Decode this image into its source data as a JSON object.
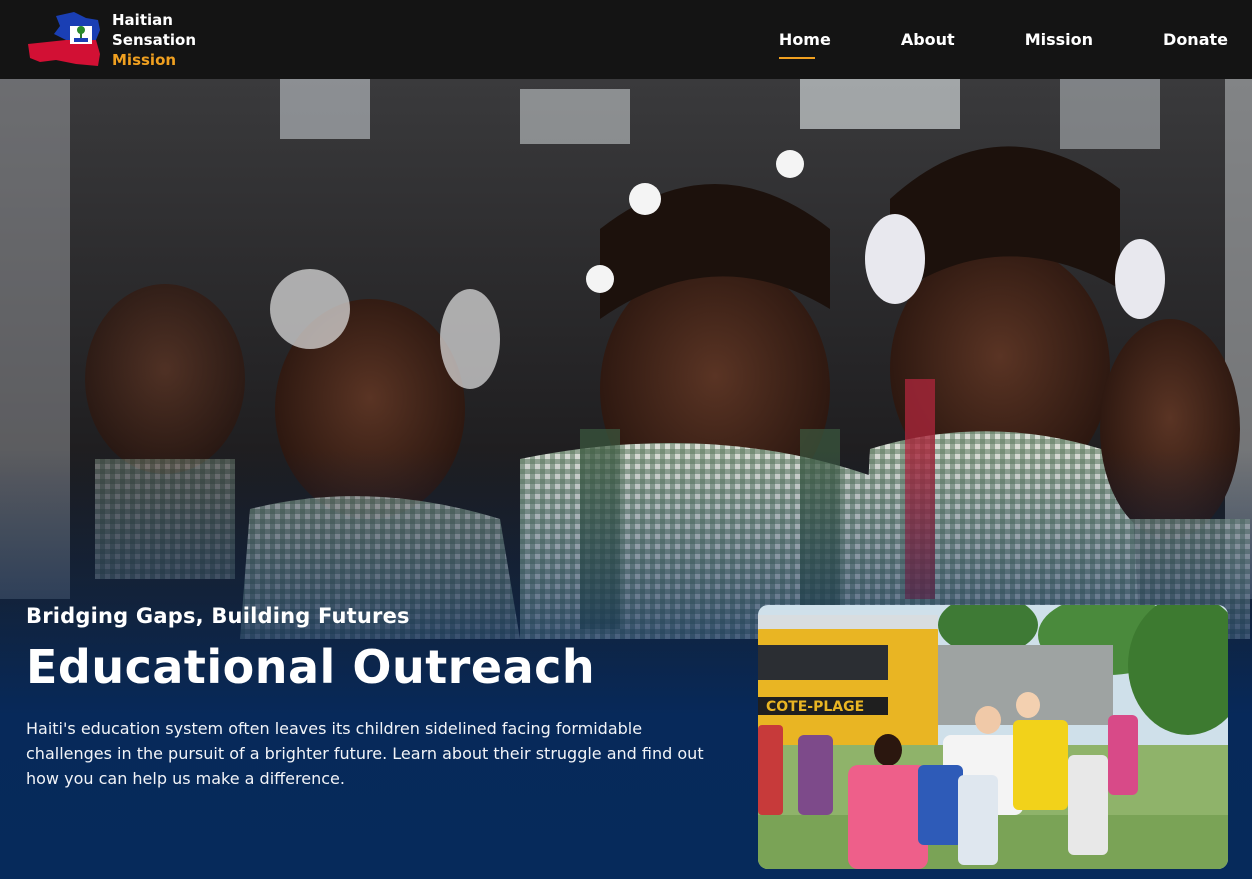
{
  "brand": {
    "line1": "Haitian",
    "line2": "Sensation",
    "line3": "Mission"
  },
  "nav": {
    "items": [
      {
        "label": "Home",
        "active": true
      },
      {
        "label": "About",
        "active": false
      },
      {
        "label": "Mission",
        "active": false
      },
      {
        "label": "Donate",
        "active": false
      }
    ]
  },
  "hero": {
    "tagline": "Bridging Gaps, Building Futures",
    "title": "Educational Outreach",
    "description": "Haiti's education system often leaves its children sidelined facing formidable challenges in the pursuit of a brighter future. Learn about their struggle and find out how you can help us make a difference.",
    "bus_sign": "COTE-PLAGE"
  },
  "colors": {
    "nav_bg": "#141414",
    "accent": "#f0a020",
    "hero_blue": "#062a5b",
    "text": "#ffffff"
  }
}
